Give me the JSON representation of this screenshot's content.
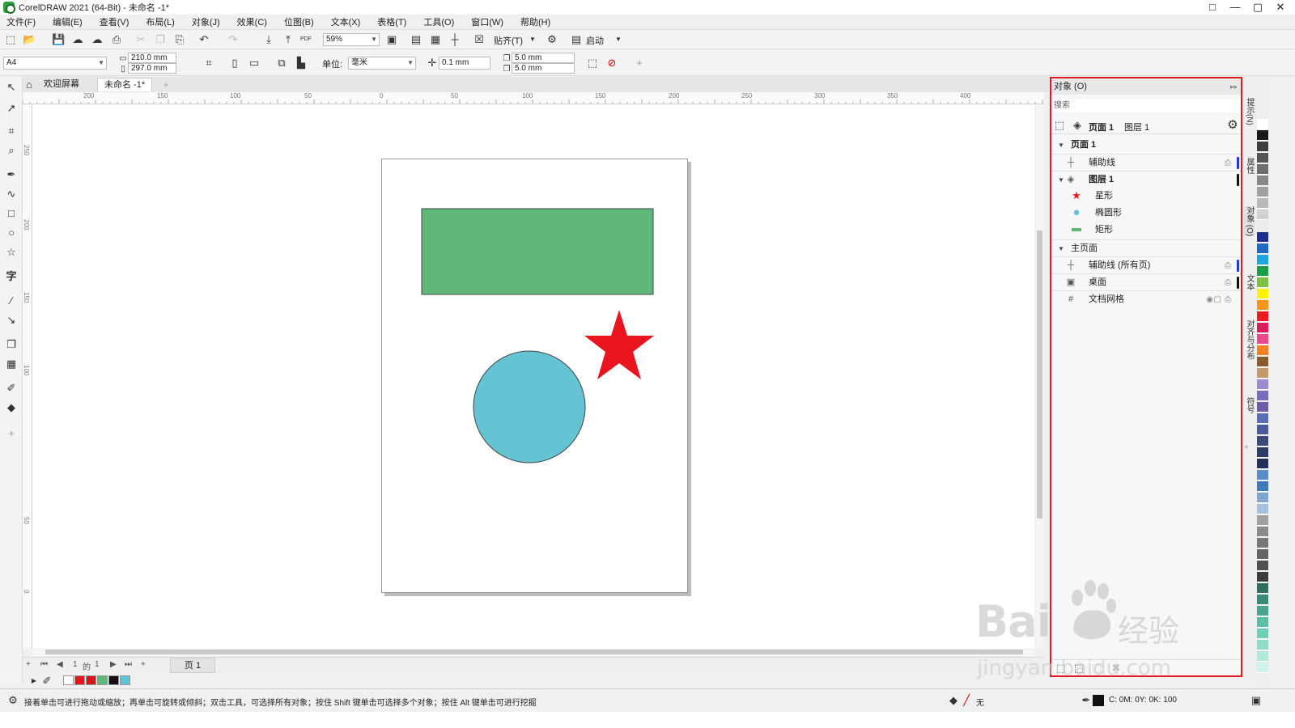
{
  "window": {
    "title": "CorelDRAW 2021 (64-Bit) - 未命名 -1*",
    "controls": [
      "□",
      "—",
      "▢",
      "✕"
    ]
  },
  "menu": [
    "文件(F)",
    "编辑(E)",
    "查看(V)",
    "布局(L)",
    "对象(J)",
    "效果(C)",
    "位图(B)",
    "文本(X)",
    "表格(T)",
    "工具(O)",
    "窗口(W)",
    "帮助(H)"
  ],
  "toolbar": {
    "zoom": "59%",
    "snap_label": "贴齐(T)",
    "launch_label": "启动",
    "pdf_label": "PDF"
  },
  "property_bar": {
    "page_size": "A4",
    "width": "210.0 mm",
    "height": "297.0 mm",
    "units_label": "单位:",
    "units_value": "毫米",
    "nudge": "0.1 mm",
    "dup_x": "5.0 mm",
    "dup_y": "5.0 mm"
  },
  "document_tabs": {
    "welcome": "欢迎屏幕",
    "document": "未命名 -1*"
  },
  "rulers": {
    "horizontal": [
      "200",
      "150",
      "100",
      "50",
      "0",
      "50",
      "100",
      "150",
      "200",
      "250",
      "300",
      "350",
      "400"
    ],
    "vertical": [
      "250",
      "200",
      "150",
      "100",
      "50",
      "0"
    ]
  },
  "page_nav": {
    "current": "1",
    "of": "的",
    "total": "1",
    "page_tab": "页 1"
  },
  "doc_palette": [
    "#e8141e",
    "#d9131b",
    "#5fb87a",
    "#111111",
    "#5ec3d6"
  ],
  "status": {
    "message": "接着单击可进行拖动或缩放；再单击可旋转或倾斜；双击工具，可选择所有对象；按住 Shift 键单击可选择多个对象；按住 Alt 键单击可进行挖掘",
    "fill_none": "无",
    "outline": "C: 0M: 0Y: 0K: 100"
  },
  "objects_docker": {
    "title": "对象 (O)",
    "search_placeholder": "搜索",
    "current_page": "页面 1",
    "current_layer": "图层 1",
    "tree": {
      "page1": "页面 1",
      "guides": "辅助线",
      "layer1": "图层 1",
      "star": "星形",
      "ellipse": "椭圆形",
      "rect": "矩形",
      "master": "主页面",
      "guides_all": "辅助线 (所有页)",
      "desktop": "桌面",
      "grid": "文档网格"
    }
  },
  "right_tabs": [
    "提示(N)",
    "属性",
    "对象 (O)",
    "文本",
    "对齐与分布",
    "符号"
  ],
  "shapes": {
    "rect_color": "#5fb87a",
    "circle_color": "#64c4d4",
    "star_color": "#e8141e"
  },
  "right_palette": [
    "#ffffff",
    "#1a1a1a",
    "#3c3c3c",
    "#555555",
    "#6e6e6e",
    "#888888",
    "#a0a0a0",
    "#b9b9b9",
    "#d2d2d2",
    "#ececec",
    "#1c2f8c",
    "#2267c4",
    "#1aa7e0",
    "#1a9e46",
    "#7bc043",
    "#fff200",
    "#f7941d",
    "#ed1c24",
    "#d91c5c",
    "#e84a8a",
    "#f58220",
    "#8b5a2b",
    "#c49a6c",
    "#9b8bd1",
    "#7a6bbf",
    "#6b5ba8",
    "#5b6fb7",
    "#4a5a9b",
    "#3d4a7e",
    "#2f3d6b",
    "#243059",
    "#5a8dc8",
    "#3f7ab8",
    "#7fa6d1",
    "#a6c0de",
    "#a0a0a0",
    "#8c8c8c",
    "#787878",
    "#646464",
    "#505050",
    "#3c3c3c",
    "#2e6e5e",
    "#3a8a78",
    "#4aa590",
    "#5bbfa8",
    "#6fcfb9",
    "#8fdcc9",
    "#b0e8da",
    "#cff2ea"
  ],
  "watermark": {
    "brand": "Bai",
    "brand2": "经验",
    "url": "jingyan.baidu.com"
  }
}
